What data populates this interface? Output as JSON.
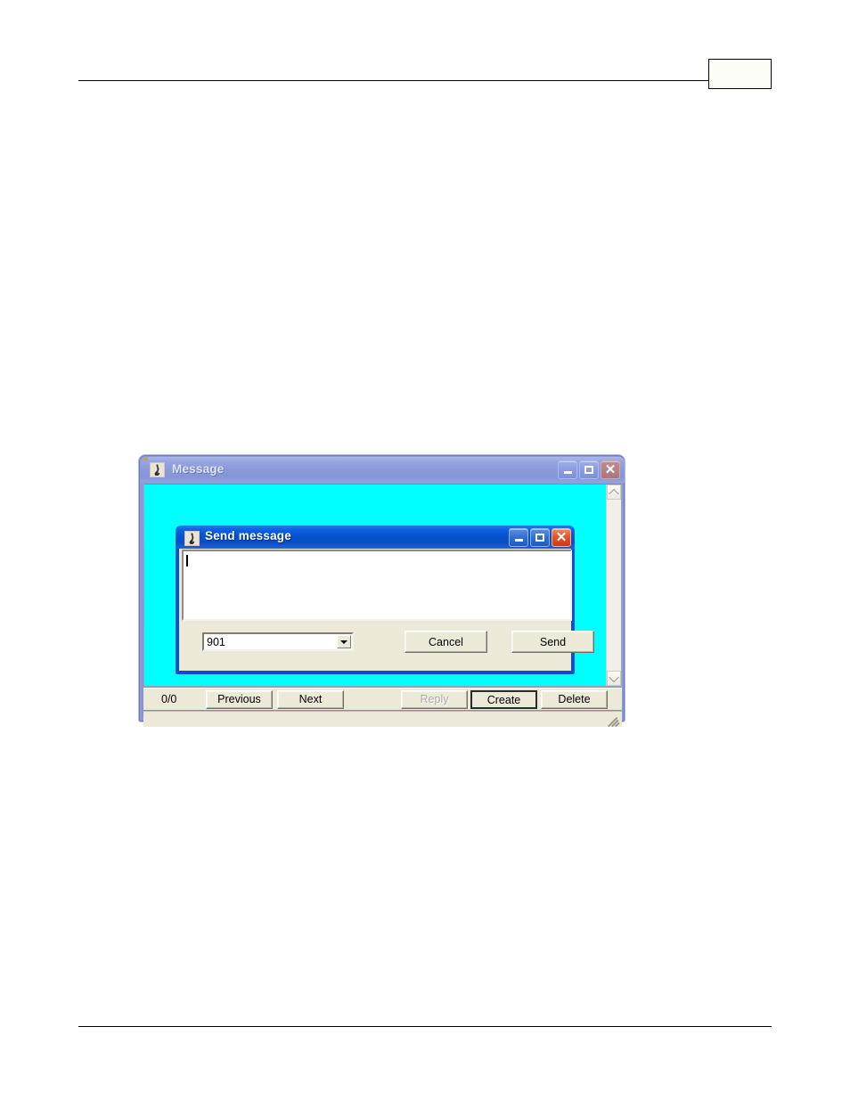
{
  "document": {
    "page_number": "",
    "header_rule": true,
    "footer_rule": true,
    "faint_marks": [
      "",
      ""
    ]
  },
  "outer_window": {
    "title": "Message",
    "icon": "app-note-icon",
    "active": false,
    "titlebar_color": "#8b9bd9",
    "client_color": "#00ffff",
    "controls": {
      "minimize": "–",
      "maximize": "□",
      "close": "✕"
    },
    "scrollbar": {
      "orientation": "vertical",
      "up_arrow": "scroll-up-icon",
      "down_arrow": "scroll-down-icon"
    },
    "toolbar": {
      "counter": "0/0",
      "buttons": [
        {
          "label": "Previous",
          "enabled": true,
          "default": false
        },
        {
          "label": "Next",
          "enabled": true,
          "default": false
        },
        {
          "label": "Reply",
          "enabled": false,
          "default": false
        },
        {
          "label": "Create",
          "enabled": true,
          "default": true
        },
        {
          "label": "Delete",
          "enabled": true,
          "default": false
        }
      ]
    },
    "statusbar": {
      "text": "",
      "resize_grip": true
    }
  },
  "inner_dialog": {
    "title": "Send message",
    "icon": "app-note-icon",
    "active": true,
    "titlebar_color": "#0653cf",
    "body_color": "#ece9d8",
    "controls": {
      "minimize": "–",
      "maximize": "□",
      "close": "✕"
    },
    "message_field": {
      "value": "",
      "placeholder": "",
      "caret_visible": true
    },
    "recipient_combo": {
      "value": "901",
      "options": [
        "901"
      ],
      "arrow": "chevron-down-icon"
    },
    "buttons": [
      {
        "label": "Cancel",
        "enabled": true
      },
      {
        "label": "Send",
        "enabled": true
      }
    ]
  }
}
